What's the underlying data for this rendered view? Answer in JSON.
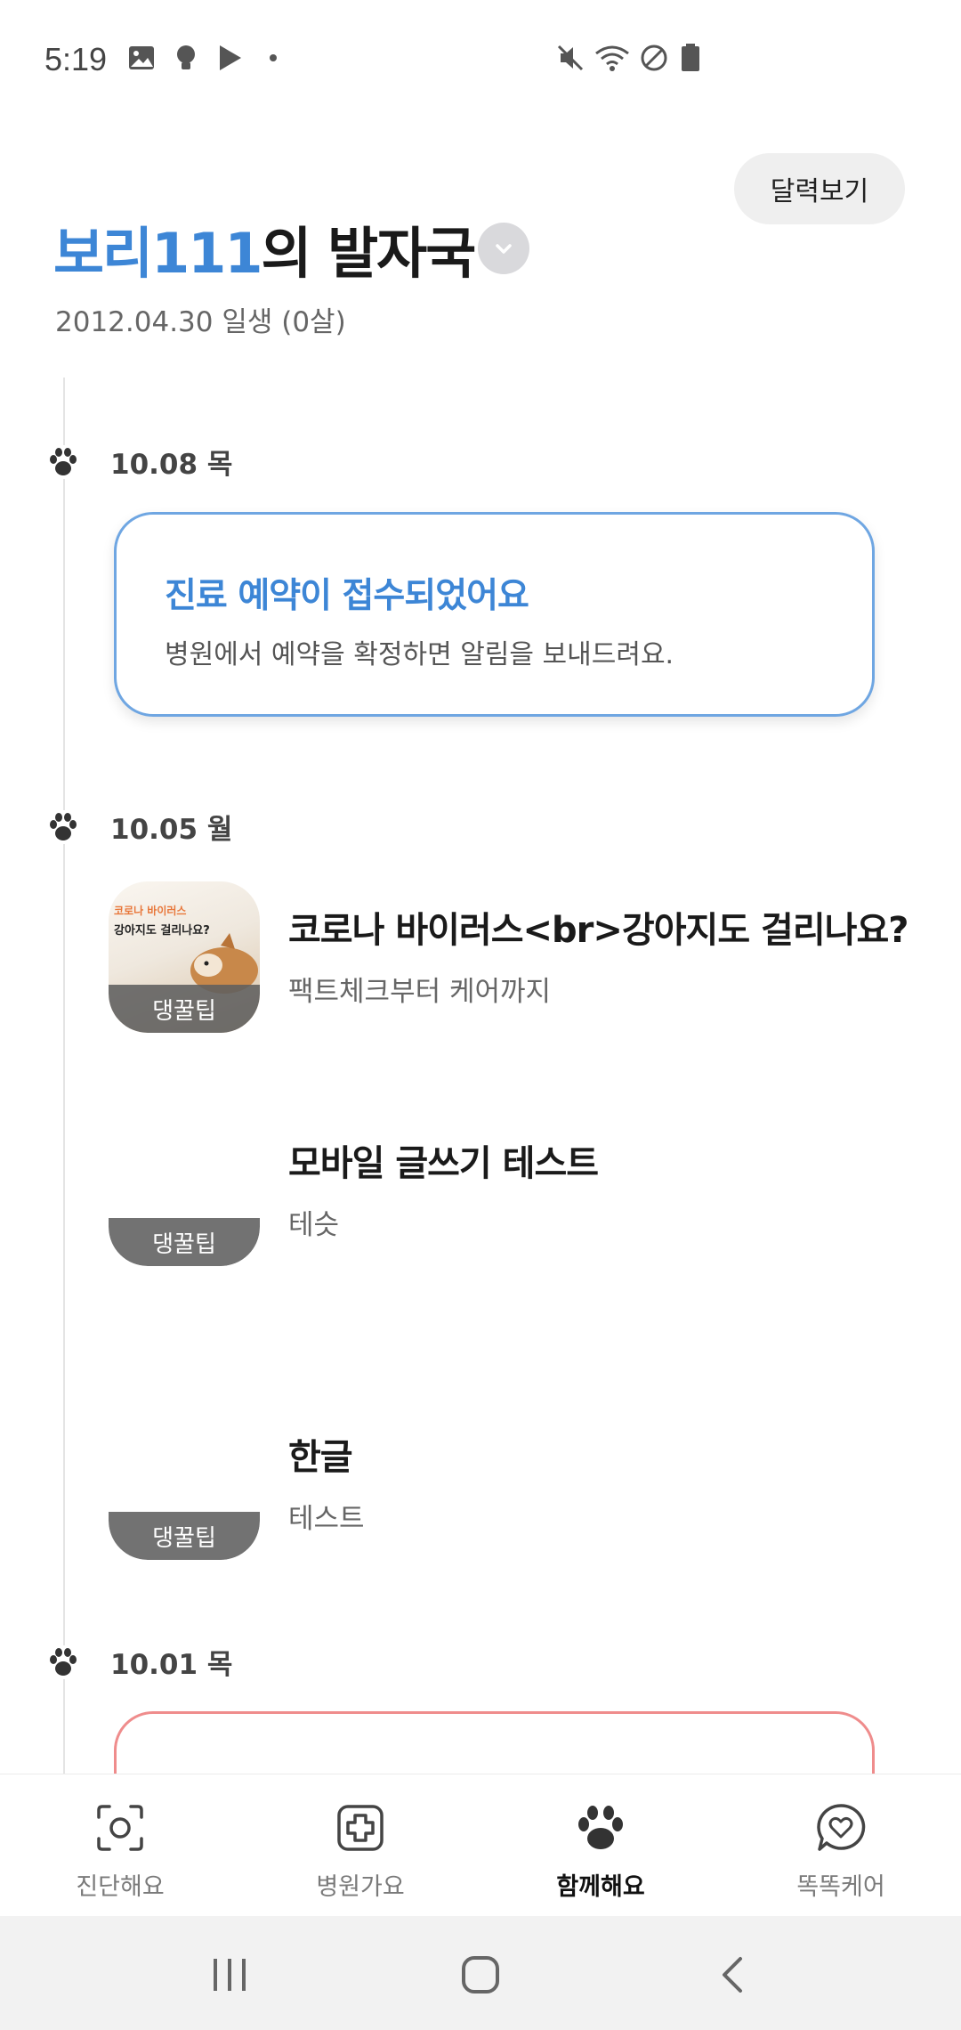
{
  "status_bar": {
    "time": "5:19"
  },
  "header": {
    "calendar_button": "달력보기",
    "pet_name": "보리111",
    "title_suffix": "의 발자국",
    "birth": "2012.04.30 일생 (0살)"
  },
  "timeline": {
    "groups": [
      {
        "date": "10.08 목"
      },
      {
        "date": "10.05 월"
      },
      {
        "date": "10.01 목"
      }
    ],
    "notice": {
      "title": "진료 예약이 접수되었어요",
      "desc": "병원에서 예약을 확정하면 알림을 보내드려요."
    },
    "articles": [
      {
        "tag": "댕꿀팁",
        "title": "코로나 바이러스<br>강아지도 걸리나요?",
        "subtitle": "팩트체크부터 케어까지",
        "thumb_line1": "코로나 바이러스",
        "thumb_line2": "강아지도 걸리나요?"
      },
      {
        "tag": "댕꿀팁",
        "title": "모바일 글쓰기 테스트",
        "subtitle": "테슷"
      },
      {
        "tag": "댕꿀팁",
        "title": "한글",
        "subtitle": "테스트"
      }
    ]
  },
  "bottom_nav": {
    "items": [
      {
        "label": "진단해요",
        "icon": "scan-icon"
      },
      {
        "label": "병원가요",
        "icon": "medical-plus-icon"
      },
      {
        "label": "함께해요",
        "icon": "paw-icon",
        "active": true
      },
      {
        "label": "똑똑케어",
        "icon": "chat-heart-icon"
      }
    ]
  },
  "colors": {
    "accent": "#3d86d6",
    "alert": "#ef8c8c"
  }
}
